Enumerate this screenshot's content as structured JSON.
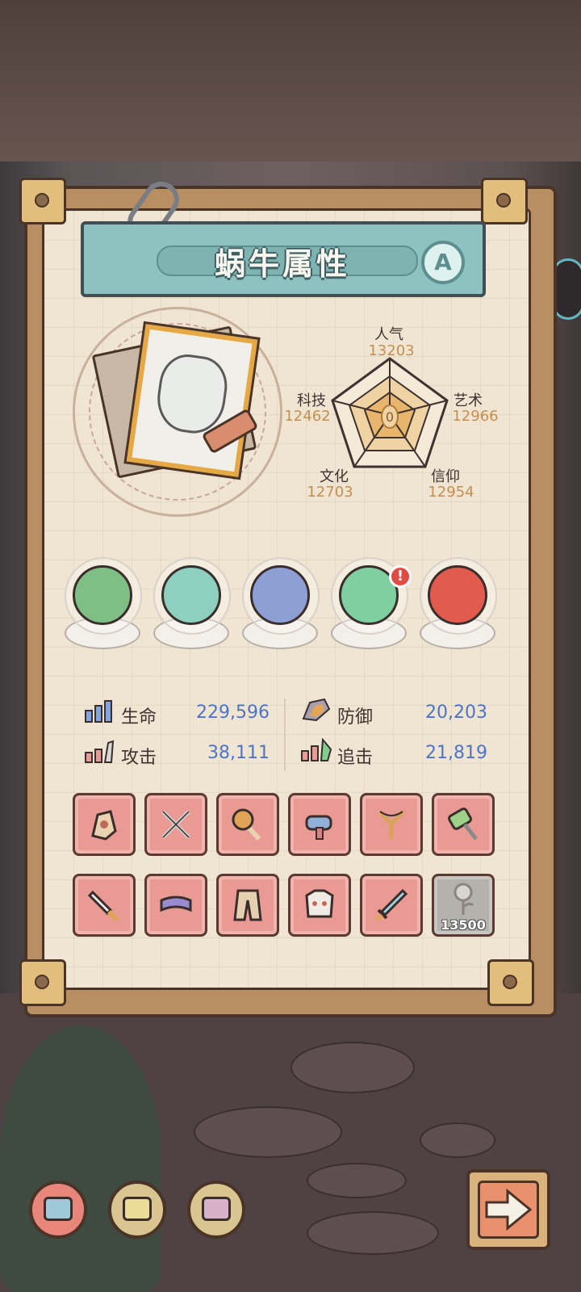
{
  "panel": {
    "title": "蜗牛属性",
    "grade": "A"
  },
  "radar": {
    "center_value": "0",
    "stats": [
      {
        "label": "人气",
        "value": "13203"
      },
      {
        "label": "艺术",
        "value": "12966"
      },
      {
        "label": "信仰",
        "value": "12954"
      },
      {
        "label": "文化",
        "value": "12703"
      },
      {
        "label": "科技",
        "value": "12462"
      }
    ]
  },
  "relics": [
    {
      "icon": "vine-orb-icon",
      "color": "#7fbf86"
    },
    {
      "icon": "gem-orb-icon",
      "color": "#8dd0c0"
    },
    {
      "icon": "compass-icon",
      "color": "#8e9fd6"
    },
    {
      "icon": "swirl-orb-icon",
      "color": "#7fcfa0",
      "badge": "!"
    },
    {
      "icon": "flame-orb-icon",
      "color": "#e2594d"
    }
  ],
  "stats": {
    "hp": {
      "label": "生命",
      "value": "229,596",
      "icon": "hp-bar-icon"
    },
    "def": {
      "label": "防御",
      "value": "20,203",
      "icon": "shield-icon"
    },
    "atk": {
      "label": "攻击",
      "value": "38,111",
      "icon": "sword-bar-icon"
    },
    "chase": {
      "label": "追击",
      "value": "21,819",
      "icon": "chase-bar-icon"
    }
  },
  "equipment": [
    {
      "icon": "gauntlet-icon"
    },
    {
      "icon": "crossed-swords-icon"
    },
    {
      "icon": "club-icon"
    },
    {
      "icon": "blaster-icon"
    },
    {
      "icon": "slingshot-icon"
    },
    {
      "icon": "hammer-icon"
    },
    {
      "icon": "dagger-icon"
    },
    {
      "icon": "headband-icon"
    },
    {
      "icon": "pants-icon"
    },
    {
      "icon": "armor-icon"
    },
    {
      "icon": "sword-icon"
    },
    {
      "icon": "rose-icon",
      "locked": true,
      "cost": "13500"
    }
  ],
  "nav": [
    {
      "icon": "snail-face-blue-icon",
      "active": true
    },
    {
      "icon": "snail-face-yellow-icon",
      "active": false
    },
    {
      "icon": "snail-face-purple-icon",
      "active": false
    }
  ],
  "colors": {
    "title_bar": "#8ec2c0",
    "stat_value": "#4d74c8",
    "radar_value": "#c58f52",
    "slot": "#e99a93"
  }
}
